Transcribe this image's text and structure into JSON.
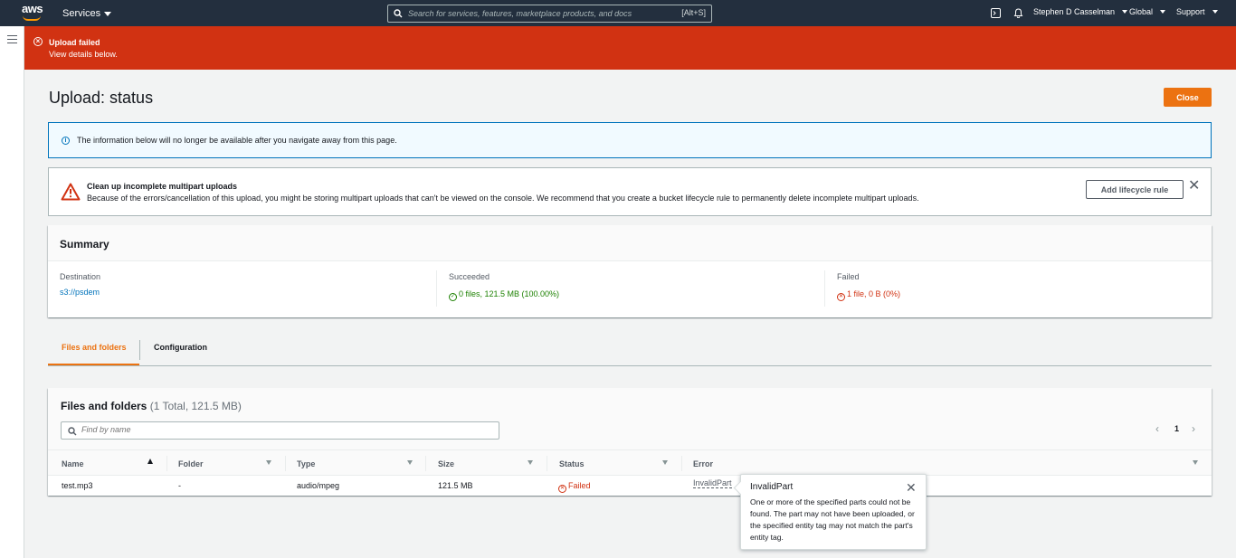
{
  "nav": {
    "logo": "aws",
    "services": "Services",
    "search_placeholder": "Search for services, features, marketplace products, and docs",
    "search_shortcut": "[Alt+S]",
    "user": "Stephen D Casselman",
    "region": "Global",
    "support": "Support"
  },
  "flash": {
    "title": "Upload failed",
    "description": "View details below.",
    "color": "#d13212"
  },
  "page": {
    "title": "Upload: status",
    "close_label": "Close"
  },
  "info": {
    "text": "The information below will no longer be available after you navigate away from this page."
  },
  "warning": {
    "title": "Clean up incomplete multipart uploads",
    "description": "Because of the errors/cancellation of this upload, you might be storing multipart uploads that can't be viewed on the console. We recommend that you create a bucket lifecycle rule to permanently delete incomplete multipart uploads.",
    "button_label": "Add lifecycle rule"
  },
  "summary": {
    "title": "Summary",
    "destination_label": "Destination",
    "destination_value": "s3://psdem",
    "succeeded_label": "Succeeded",
    "succeeded_value": "0 files, 121.5 MB (100.00%)",
    "failed_label": "Failed",
    "failed_value": "1 file, 0 B (0%)"
  },
  "tabs": [
    {
      "label": "Files and folders",
      "active": true
    },
    {
      "label": "Configuration",
      "active": false
    }
  ],
  "files": {
    "title": "Files and folders",
    "count": "(1 Total, 121.5 MB)",
    "search_placeholder": "Find by name",
    "page": "1",
    "columns": [
      "Name",
      "Folder",
      "Type",
      "Size",
      "Status",
      "Error"
    ],
    "rows": [
      {
        "name": "test.mp3",
        "folder": "-",
        "type": "audio/mpeg",
        "size": "121.5 MB",
        "status": "Failed",
        "error": "InvalidPart"
      }
    ]
  },
  "popover": {
    "title": "InvalidPart",
    "body": "One or more of the specified parts could not be found. The part may not have been uploaded, or the specified entity tag may not match the part's entity tag."
  }
}
